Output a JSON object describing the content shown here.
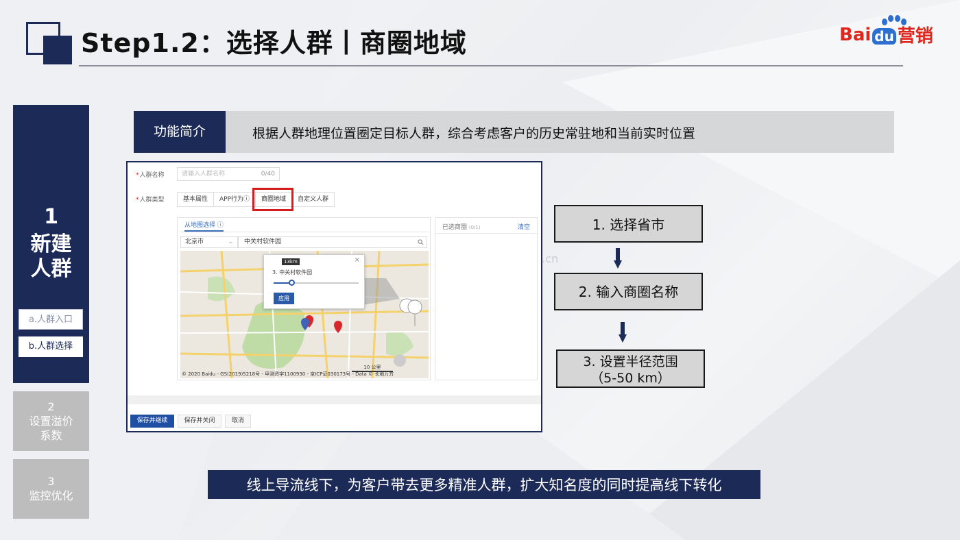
{
  "header": {
    "title": "Step1.2：选择人群丨商圈地域",
    "logo_left": "Bai",
    "logo_du": "du",
    "logo_right": "营销"
  },
  "nav": {
    "main_num": "1",
    "main_line1": "新建",
    "main_line2": "人群",
    "sub_a": "a.人群入口",
    "sub_b": "b.人群选择",
    "step2_num": "2",
    "step2_line1": "设置溢价",
    "step2_line2": "系数",
    "step3_num": "3",
    "step3_line1": "监控优化"
  },
  "function": {
    "tag": "功能简介",
    "description": "根据人群地理位置圈定目标人群，综合考虑客户的历史常驻地和当前实时位置"
  },
  "form": {
    "name_label": "人群名称",
    "name_placeholder": "请输入人群名称",
    "name_count": "0/40",
    "type_label": "人群类型",
    "tabs": [
      "基本属性",
      "APP行为",
      "商圈地域",
      "自定义人群"
    ],
    "map_tab": "从地图选择",
    "city": "北京市",
    "search_value": "中关村软件园",
    "popup_title": "3. 中关村软件园",
    "popup_km": "13km",
    "popup_apply": "应用",
    "map_footer": "© 2020 Baidu - GS(2019)5218号 - 甲测资字1100930 - 京ICP证030173号 - Data © 长地万方",
    "scale": "10 公里",
    "selected_title": "已选商圈",
    "selected_count": "(0/1)",
    "selected_clear": "清空",
    "btn_save_continue": "保存并继续",
    "btn_save_close": "保存并关闭",
    "btn_cancel": "取消"
  },
  "flow": {
    "step1": "1. 选择省市",
    "step2": "2. 输入商圈名称",
    "step3_line1": "3. 设置半径范围",
    "step3_line2": "（5-50 km）"
  },
  "watermark": "kesiyi.cn",
  "bottom_banner": "线上导流线下，为客户带去更多精准人群，扩大知名度的同时提高线下转化",
  "colors": {
    "navy": "#1c2a57",
    "step_gray": "#bdbdbd",
    "highlight_red": "#d51b1b",
    "baidu_red": "#e0261c",
    "baidu_blue": "#2c6fd1"
  }
}
